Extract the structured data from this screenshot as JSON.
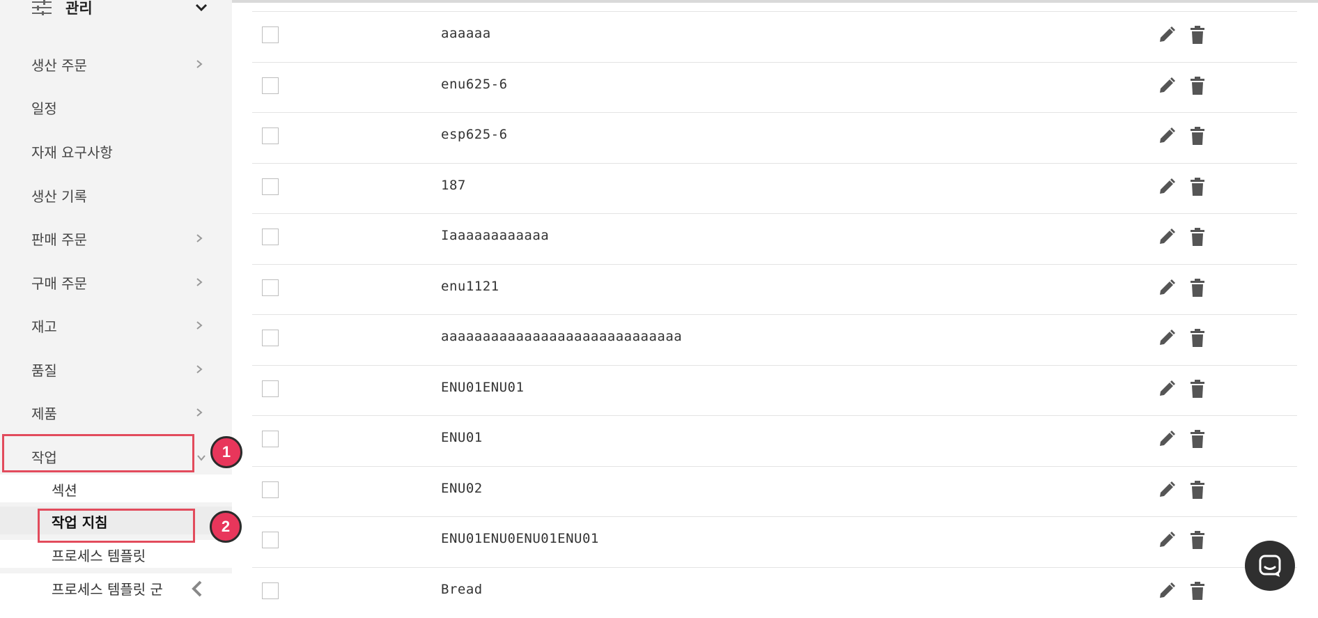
{
  "sidebar": {
    "header": {
      "title": "관리",
      "icon": "sliders-icon",
      "toggle_icon": "chevron-down-icon"
    },
    "items": [
      {
        "label": "생산 주문",
        "has_arrow": true
      },
      {
        "label": "일정",
        "has_arrow": false
      },
      {
        "label": "자재 요구사항",
        "has_arrow": false
      },
      {
        "label": "생산 기록",
        "has_arrow": false
      },
      {
        "label": "판매 주문",
        "has_arrow": true
      },
      {
        "label": "구매 주문",
        "has_arrow": true
      },
      {
        "label": "재고",
        "has_arrow": true
      },
      {
        "label": "품질",
        "has_arrow": true
      },
      {
        "label": "제품",
        "has_arrow": true
      },
      {
        "label": "작업",
        "has_arrow": true,
        "expanded": true
      }
    ],
    "subitems": [
      {
        "label": "섹션"
      },
      {
        "label": "작업 지침",
        "active": true
      },
      {
        "label": "프로세스 템플릿"
      },
      {
        "label": "프로세스 템플릿 군"
      }
    ],
    "collapse_icon": "chevron-left-icon"
  },
  "annotations": {
    "badge1": "1",
    "badge2": "2",
    "highlight_color": "#e24b5c",
    "badge_color": "#e8365b"
  },
  "table": {
    "rows": [
      {
        "name": "aaaaaa"
      },
      {
        "name": "enu625-6"
      },
      {
        "name": "esp625-6"
      },
      {
        "name": "187"
      },
      {
        "name": "Iaaaaaaaaaaaa"
      },
      {
        "name": "enu1121"
      },
      {
        "name": "aaaaaaaaaaaaaaaaaaaaaaaaaaaaa"
      },
      {
        "name": "ENU01ENU01"
      },
      {
        "name": "ENU01"
      },
      {
        "name": "ENU02"
      },
      {
        "name": "ENU01ENU0ENU01ENU01"
      },
      {
        "name": "Bread"
      }
    ],
    "row_icons": {
      "edit": "pencil-icon",
      "delete": "trash-icon"
    }
  },
  "chat": {
    "icon": "chat-icon"
  }
}
